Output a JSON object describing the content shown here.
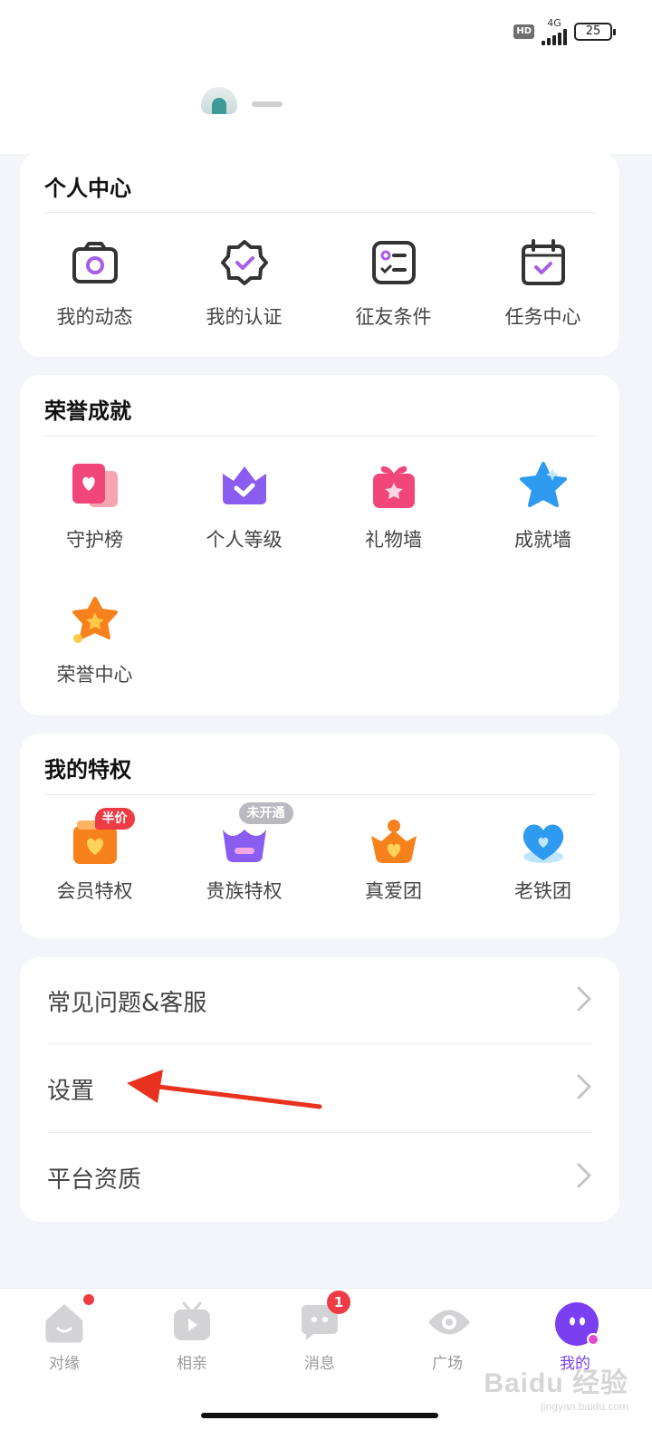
{
  "status_bar": {
    "hd": "HD",
    "network": "4G",
    "battery": "25"
  },
  "personal_center": {
    "title": "个人中心",
    "items": [
      {
        "label": "我的动态",
        "icon": "camera-icon"
      },
      {
        "label": "我的认证",
        "icon": "verified-badge-icon"
      },
      {
        "label": "征友条件",
        "icon": "checklist-icon"
      },
      {
        "label": "任务中心",
        "icon": "calendar-check-icon"
      }
    ]
  },
  "honor": {
    "title": "荣誉成就",
    "items": [
      {
        "label": "守护榜",
        "icon": "heart-card-icon"
      },
      {
        "label": "个人等级",
        "icon": "crown-icon"
      },
      {
        "label": "礼物墙",
        "icon": "gift-icon"
      },
      {
        "label": "成就墙",
        "icon": "star-icon"
      },
      {
        "label": "荣誉中心",
        "icon": "honor-star-icon"
      }
    ]
  },
  "privileges": {
    "title": "我的特权",
    "items": [
      {
        "label": "会员特权",
        "icon": "vip-heart-icon",
        "badge": "半价"
      },
      {
        "label": "贵族特权",
        "icon": "noble-crown-icon",
        "badge": "未开通"
      },
      {
        "label": "真爱团",
        "icon": "true-love-icon"
      },
      {
        "label": "老铁团",
        "icon": "old-friend-heart-icon"
      }
    ]
  },
  "menu": {
    "items": [
      {
        "label": "常见问题&客服"
      },
      {
        "label": "设置"
      },
      {
        "label": "平台资质"
      }
    ]
  },
  "tabbar": {
    "items": [
      {
        "label": "对缘",
        "icon": "house-face-icon",
        "dot": true
      },
      {
        "label": "相亲",
        "icon": "tv-play-icon"
      },
      {
        "label": "消息",
        "icon": "chat-bubble-icon",
        "count": "1"
      },
      {
        "label": "广场",
        "icon": "eye-icon"
      },
      {
        "label": "我的",
        "icon": "profile-face-icon",
        "active": true
      }
    ]
  },
  "watermark": {
    "line1": "Baidu 经验",
    "line2": "jingyan.baidu.com"
  },
  "colors": {
    "accent": "#7b3ff2",
    "annotation_arrow": "#e8321e",
    "badge_red": "#ef3b45"
  }
}
